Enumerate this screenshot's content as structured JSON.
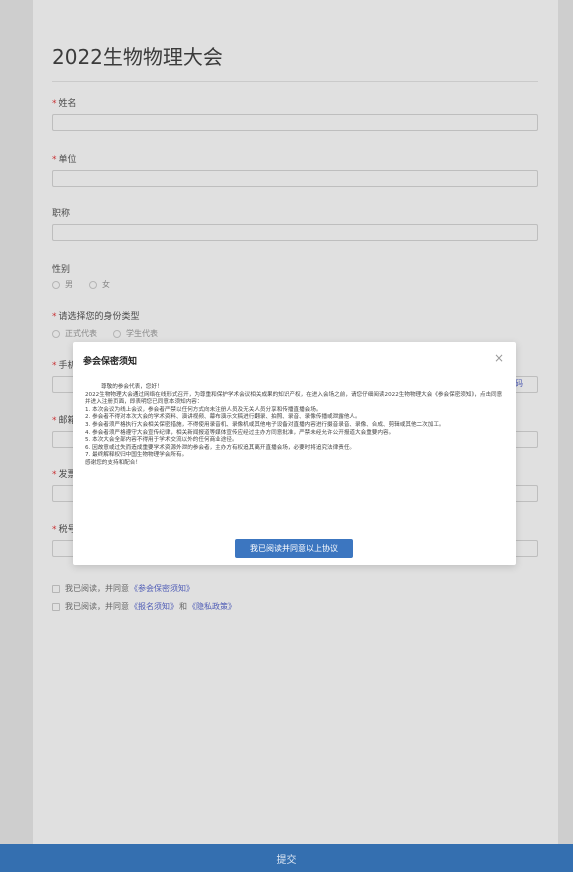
{
  "form": {
    "title": "2022生物物理大会",
    "fields": {
      "name": "姓名",
      "unit": "单位",
      "job_title": "职称",
      "gender": "性别",
      "identity": "请选择您的身份类型"
    },
    "gender_options": [
      "男",
      "女"
    ],
    "identity_options": [
      "正式代表",
      "学生代表"
    ],
    "peek_labels": [
      "手机",
      "邮箱",
      "发票",
      "税号"
    ],
    "verify_code_fragment": "码",
    "agreements": {
      "row1_prefix": "我已阅读，并同意",
      "row1_link": "《参会保密须知》",
      "row2_prefix": "我已阅读，并同意",
      "row2_link1": "《报名须知》",
      "row2_and": "和",
      "row2_link2": "《隐私政策》"
    },
    "submit_label": "提交"
  },
  "modal": {
    "title": "参会保密须知",
    "close_symbol": "×",
    "greeting": "尊敬的参会代表，您好！",
    "intro": "2022生物物理大会通过网络在线形式召开，为尊重和保护学术会议相关成果的知识产权，在进入会场之前，请您仔细阅读2022生物物理大会《参会保密须知》，点击同意并进入注册页面，即表明您已同意本须知内容：",
    "items": [
      "1. 本次会议为线上会议，参会者严禁以任何方式向未注册人员及无关人员分享和传播直播会场。",
      "2. 参会者不得对本次大会的学术资料、演讲视频、幕布演示文稿进行翻录、拍照、录音、录像传播或泄露他人。",
      "3. 参会者须严格执行大会相关保密措施，不得使用录音机、录像机或其他电子设备对直播内容进行摄音录音、录像、合成、剪辑或其他二次加工。",
      "4. 参会者须严格遵守大会宣传纪律，相关新闻报道等媒体宣传应经过主办方同意批准，严禁未经允许公开报道大会重要内容。",
      "5. 本次大会全部内容不得用于学术交流以外的任何商业途径。",
      "6. 因故意或过失而造成重要学术资源外泄的参会者，主办方有权追其离开直播会场，必要时将追究法律责任。",
      "7. 最终解释权归中国生物物理学会所有。"
    ],
    "closing": "感谢您的支持和配合！",
    "agree_label": "我已阅读并同意以上协议"
  }
}
